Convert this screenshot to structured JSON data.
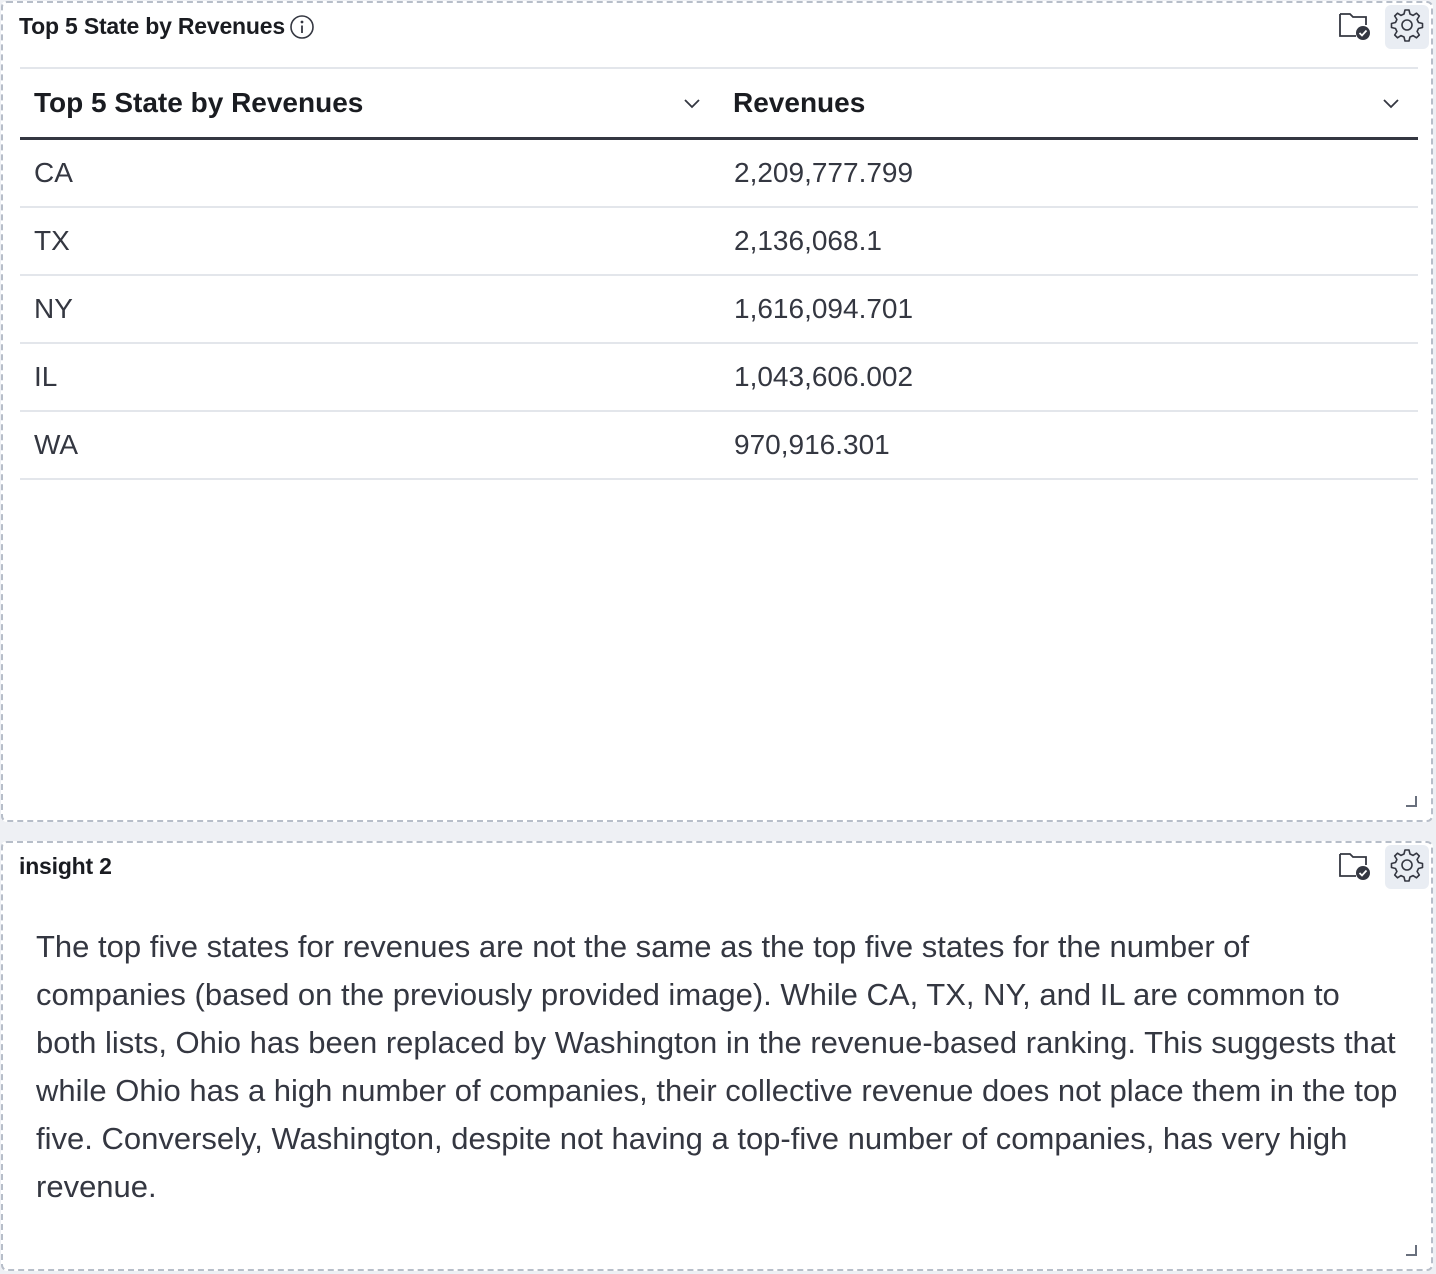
{
  "panel1": {
    "title": "Top 5 State by Revenues",
    "table": {
      "columns": [
        "Top 5 State by Revenues",
        "Revenues"
      ],
      "rows": [
        [
          "CA",
          "2,209,777.799"
        ],
        [
          "TX",
          "2,136,068.1"
        ],
        [
          "NY",
          "1,616,094.701"
        ],
        [
          "IL",
          "1,043,606.002"
        ],
        [
          "WA",
          "970,916.301"
        ]
      ]
    },
    "icons": [
      "info-icon",
      "folder-check-icon",
      "gear-icon",
      "chevron-down-icon",
      "resize-handle-icon"
    ]
  },
  "panel2": {
    "title": "insight 2",
    "text": "The top five states for revenues are not the same as the top five states for the number of companies (based on the previously provided image). While CA, TX, NY, and IL are common to both lists, Ohio has been replaced by Washington in the revenue-based ranking. This suggests that while Ohio has a high number of companies, their collective revenue does not place them in the top five. Conversely, Washington, despite not having a top-five number of companies, has very high revenue.",
    "icons": [
      "folder-check-icon",
      "gear-icon",
      "resize-handle-icon"
    ]
  },
  "colors": {
    "background": "#eef0f4",
    "panel_border": "#b7bec9",
    "header_rule": "#343741",
    "row_rule": "#e3e6eb",
    "gear_bg": "#e9edf3"
  }
}
